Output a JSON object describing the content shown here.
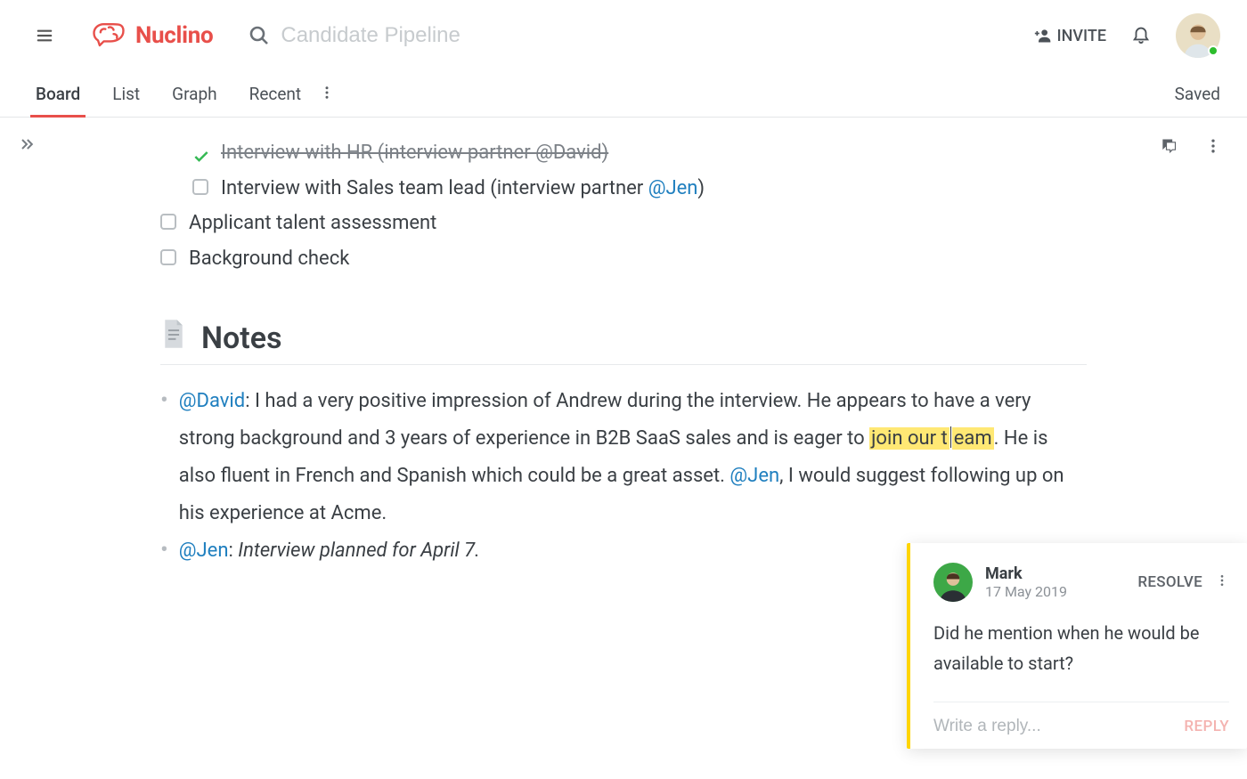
{
  "topbar": {
    "logo_text": "Nuclino",
    "search_placeholder": "Candidate Pipeline",
    "invite_label": "INVITE"
  },
  "tabs": {
    "items": [
      "Board",
      "List",
      "Graph",
      "Recent"
    ],
    "active_index": 0,
    "status_label": "Saved"
  },
  "checklist": [
    {
      "done": true,
      "indent": 1,
      "segments": [
        {
          "text": "Interview with HR (interview partner ",
          "kind": "strike"
        },
        {
          "text": "@David",
          "kind": "mention-strike"
        },
        {
          "text": ")",
          "kind": "strike"
        }
      ]
    },
    {
      "done": false,
      "indent": 1,
      "segments": [
        {
          "text": "Interview with Sales team lead  (interview partner ",
          "kind": "plain"
        },
        {
          "text": "@Jen",
          "kind": "mention"
        },
        {
          "text": ")",
          "kind": "plain"
        }
      ]
    },
    {
      "done": false,
      "indent": 0,
      "segments": [
        {
          "text": "Applicant talent assessment",
          "kind": "plain"
        }
      ]
    },
    {
      "done": false,
      "indent": 0,
      "segments": [
        {
          "text": "Background check",
          "kind": "plain"
        }
      ]
    }
  ],
  "notes_heading": "Notes",
  "notes": [
    {
      "segments": [
        {
          "text": "@David",
          "kind": "mention"
        },
        {
          "text": ": I had a very positive impression of Andrew during the interview. He appears to have a very strong background and 3 years of experience in B2B SaaS sales and is eager to ",
          "kind": "plain"
        },
        {
          "text": "join our t",
          "kind": "highlight"
        },
        {
          "text": "",
          "kind": "caret"
        },
        {
          "text": "eam",
          "kind": "highlight"
        },
        {
          "text": ". He is also fluent in French and Spanish which could be a great asset. ",
          "kind": "plain"
        },
        {
          "text": "@Jen",
          "kind": "mention"
        },
        {
          "text": ", I would suggest following up on his experience at Acme.",
          "kind": "plain"
        }
      ]
    },
    {
      "segments": [
        {
          "text": "@Jen",
          "kind": "mention"
        },
        {
          "text": ": ",
          "kind": "plain"
        },
        {
          "text": "Interview planned for April 7.",
          "kind": "italic"
        }
      ]
    }
  ],
  "comment": {
    "author": "Mark",
    "date": "17 May 2019",
    "resolve_label": "RESOLVE",
    "text": "Did he mention when he would be available to start?",
    "reply_placeholder": "Write a reply...",
    "reply_label": "REPLY"
  }
}
